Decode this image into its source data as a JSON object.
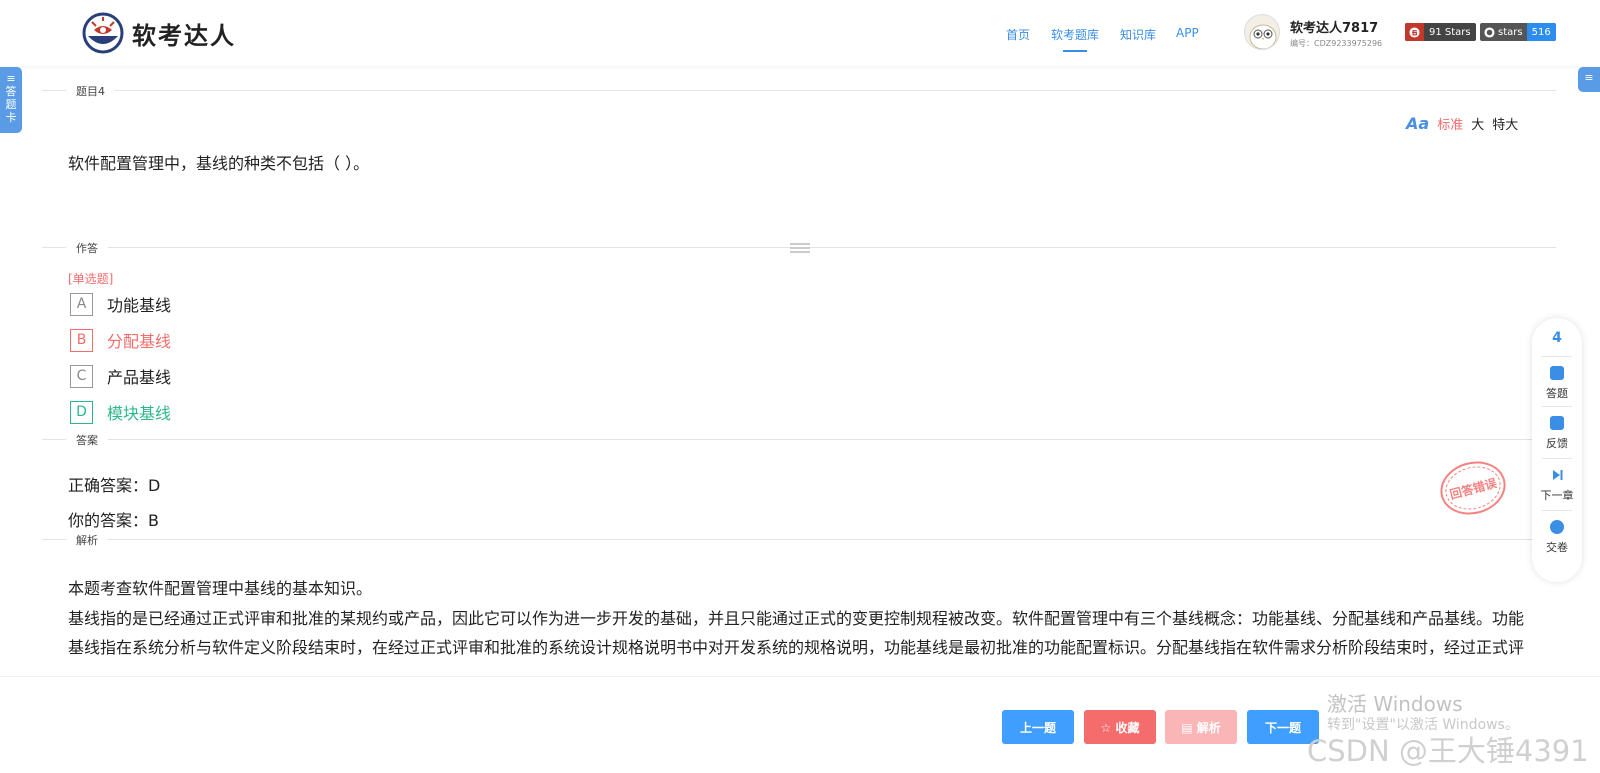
{
  "header": {
    "logo_text": "软考达人",
    "nav": [
      {
        "label": "首页",
        "active": false
      },
      {
        "label": "软考题库",
        "active": true
      },
      {
        "label": "知识库",
        "active": false
      },
      {
        "label": "APP",
        "active": false
      }
    ],
    "user_name": "软考达人7817",
    "user_id": "编号：CDZ9233975296",
    "badges": [
      {
        "left": "",
        "right": "91 Stars",
        "color": "#c0392b"
      },
      {
        "left": "stars",
        "right": "516",
        "color": "#2d8cf0"
      }
    ]
  },
  "side_left_label": "答题卡",
  "section_labels": {
    "question": "题目4",
    "answer_area": "作答",
    "answer": "答案",
    "analysis": "解析"
  },
  "font_switch": {
    "options": [
      "标准",
      "大",
      "特大"
    ],
    "active": "标准"
  },
  "question_text": "软件配置管理中，基线的种类不包括（ ）。",
  "question_type": "[单选题]",
  "options": [
    {
      "letter": "A",
      "text": "功能基线",
      "state": "normal"
    },
    {
      "letter": "B",
      "text": "分配基线",
      "state": "wrong"
    },
    {
      "letter": "C",
      "text": "产品基线",
      "state": "normal"
    },
    {
      "letter": "D",
      "text": "模块基线",
      "state": "right"
    }
  ],
  "answer": {
    "correct": "正确答案：D",
    "yours": "你的答案：B"
  },
  "stamp_text": "回答错误",
  "analysis": [
    "本题考查软件配置管理中基线的基本知识。",
    "基线指的是已经通过正式评审和批准的某规约或产品，因此它可以作为进一步开发的基础，并且只能通过正式的变更控制规程被改变。软件配置管理中有三个基线概念：功能基线、分配基线和产品基线。功能基线指在系统分析与软件定义阶段结束时，在经过正式评审和批准的系统设计规格说明书中对开发系统的规格说明，功能基线是最初批准的功能配置标识。分配基线指在软件需求分析阶段结束时，经过正式评审和批准的软件需求规格说明，分配基线是最初批准的分配配置标识；产品基线指在软件组装与系统测试阶段结束时，经过正式评审和批准的有关软件产品的全部配置项的规"
  ],
  "float_panel": {
    "number": "4",
    "items": [
      "答题",
      "反馈",
      "下一章",
      "交卷"
    ]
  },
  "buttons": {
    "prev": "上一题",
    "fav": "☆ 收藏",
    "analysis": "▤ 解析",
    "next": "下一题"
  },
  "watermarks": {
    "windows_title": "激活 Windows",
    "windows_sub": "转到\"设置\"以激活 Windows。",
    "csdn": "CSDN @王大锤4391"
  }
}
